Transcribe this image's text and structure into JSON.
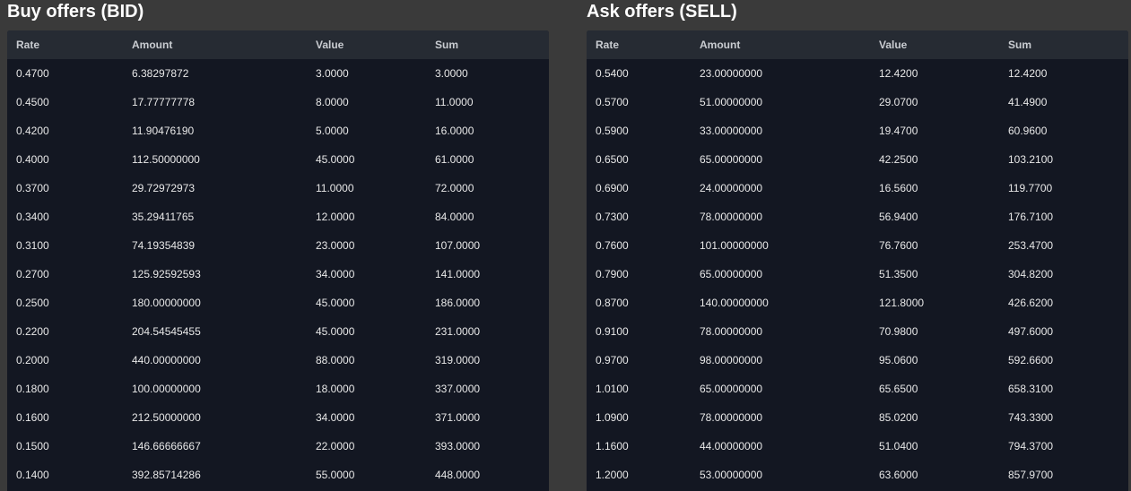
{
  "bid": {
    "title": "Buy offers (BID)",
    "columns": [
      "Rate",
      "Amount",
      "Value",
      "Sum"
    ],
    "rows": [
      [
        "0.4700",
        "6.38297872",
        "3.0000",
        "3.0000"
      ],
      [
        "0.4500",
        "17.77777778",
        "8.0000",
        "11.0000"
      ],
      [
        "0.4200",
        "11.90476190",
        "5.0000",
        "16.0000"
      ],
      [
        "0.4000",
        "112.50000000",
        "45.0000",
        "61.0000"
      ],
      [
        "0.3700",
        "29.72972973",
        "11.0000",
        "72.0000"
      ],
      [
        "0.3400",
        "35.29411765",
        "12.0000",
        "84.0000"
      ],
      [
        "0.3100",
        "74.19354839",
        "23.0000",
        "107.0000"
      ],
      [
        "0.2700",
        "125.92592593",
        "34.0000",
        "141.0000"
      ],
      [
        "0.2500",
        "180.00000000",
        "45.0000",
        "186.0000"
      ],
      [
        "0.2200",
        "204.54545455",
        "45.0000",
        "231.0000"
      ],
      [
        "0.2000",
        "440.00000000",
        "88.0000",
        "319.0000"
      ],
      [
        "0.1800",
        "100.00000000",
        "18.0000",
        "337.0000"
      ],
      [
        "0.1600",
        "212.50000000",
        "34.0000",
        "371.0000"
      ],
      [
        "0.1500",
        "146.66666667",
        "22.0000",
        "393.0000"
      ],
      [
        "0.1400",
        "392.85714286",
        "55.0000",
        "448.0000"
      ]
    ]
  },
  "ask": {
    "title": "Ask offers (SELL)",
    "columns": [
      "Rate",
      "Amount",
      "Value",
      "Sum"
    ],
    "rows": [
      [
        "0.5400",
        "23.00000000",
        "12.4200",
        "12.4200"
      ],
      [
        "0.5700",
        "51.00000000",
        "29.0700",
        "41.4900"
      ],
      [
        "0.5900",
        "33.00000000",
        "19.4700",
        "60.9600"
      ],
      [
        "0.6500",
        "65.00000000",
        "42.2500",
        "103.2100"
      ],
      [
        "0.6900",
        "24.00000000",
        "16.5600",
        "119.7700"
      ],
      [
        "0.7300",
        "78.00000000",
        "56.9400",
        "176.7100"
      ],
      [
        "0.7600",
        "101.00000000",
        "76.7600",
        "253.4700"
      ],
      [
        "0.7900",
        "65.00000000",
        "51.3500",
        "304.8200"
      ],
      [
        "0.8700",
        "140.00000000",
        "121.8000",
        "426.6200"
      ],
      [
        "0.9100",
        "78.00000000",
        "70.9800",
        "497.6000"
      ],
      [
        "0.9700",
        "98.00000000",
        "95.0600",
        "592.6600"
      ],
      [
        "1.0100",
        "65.00000000",
        "65.6500",
        "658.3100"
      ],
      [
        "1.0900",
        "78.00000000",
        "85.0200",
        "743.3300"
      ],
      [
        "1.1600",
        "44.00000000",
        "51.0400",
        "794.3700"
      ],
      [
        "1.2000",
        "53.00000000",
        "63.6000",
        "857.9700"
      ]
    ]
  }
}
